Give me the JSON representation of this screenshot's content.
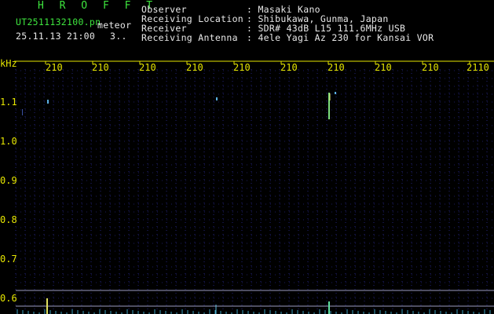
{
  "header": {
    "app_title": "H R O F F T",
    "filename": "UT2511132100.pn",
    "mode": "meteor",
    "datetime": "25.11.13 21:00",
    "page_indicator": "3.."
  },
  "info": [
    {
      "label": "Observer",
      "value": ": Masaki Kano"
    },
    {
      "label": "Receiving Location",
      "value": ": Shibukawa, Gunma, Japan"
    },
    {
      "label": "Receiver",
      "value": ": SDR# 43dB L15 111.6MHz USB"
    },
    {
      "label": "Receiving Antenna",
      "value": ": 4ele Yagi Az 230 for Kansai VOR"
    }
  ],
  "axis": {
    "y_unit": "kHz",
    "x_ticks": [
      "210",
      "210",
      "210",
      "210",
      "210",
      "210",
      "210",
      "210",
      "210",
      "2110"
    ],
    "y_ticks": [
      "1.1",
      "1.0",
      "0.9",
      "0.8",
      "0.7",
      "0.6"
    ]
  },
  "colors": {
    "label_green": "#3ee53e",
    "text_white": "#e8e8e8",
    "axis_yellow": "#e6e600",
    "grid_blue": "#2a2a8a"
  }
}
